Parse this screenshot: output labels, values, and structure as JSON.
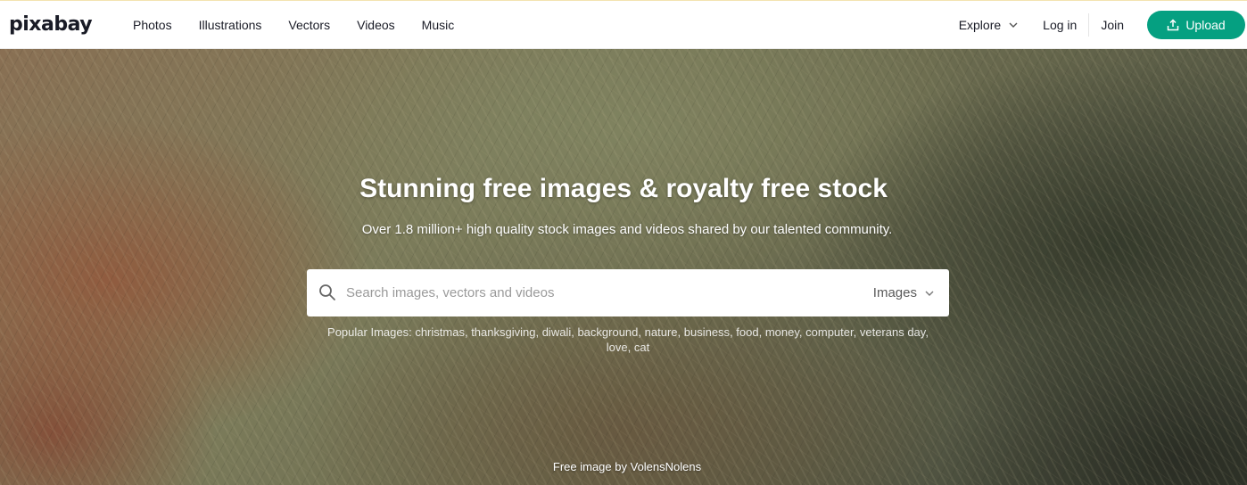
{
  "header": {
    "logo": "pixabay",
    "nav": [
      "Photos",
      "Illustrations",
      "Vectors",
      "Videos",
      "Music"
    ],
    "explore": "Explore",
    "login": "Log in",
    "join": "Join",
    "upload": "Upload",
    "accent_color": "#05a081"
  },
  "hero": {
    "title": "Stunning free images & royalty free stock",
    "subtitle": "Over 1.8 million+ high quality stock images and videos shared by our talented community.",
    "search": {
      "placeholder": "Search images, vectors and videos",
      "value": "",
      "type_selected": "Images"
    },
    "popular_label": "Popular Images:",
    "popular_tags": [
      "christmas",
      "thanksgiving",
      "diwali",
      "background",
      "nature",
      "business",
      "food",
      "money",
      "computer",
      "veterans day",
      "love",
      "cat"
    ],
    "credit_prefix": "Free image by",
    "credit_author": "VolensNolens"
  },
  "icons": {
    "search": "search-icon",
    "upload": "upload-icon",
    "chevron": "chevron-down-icon"
  }
}
